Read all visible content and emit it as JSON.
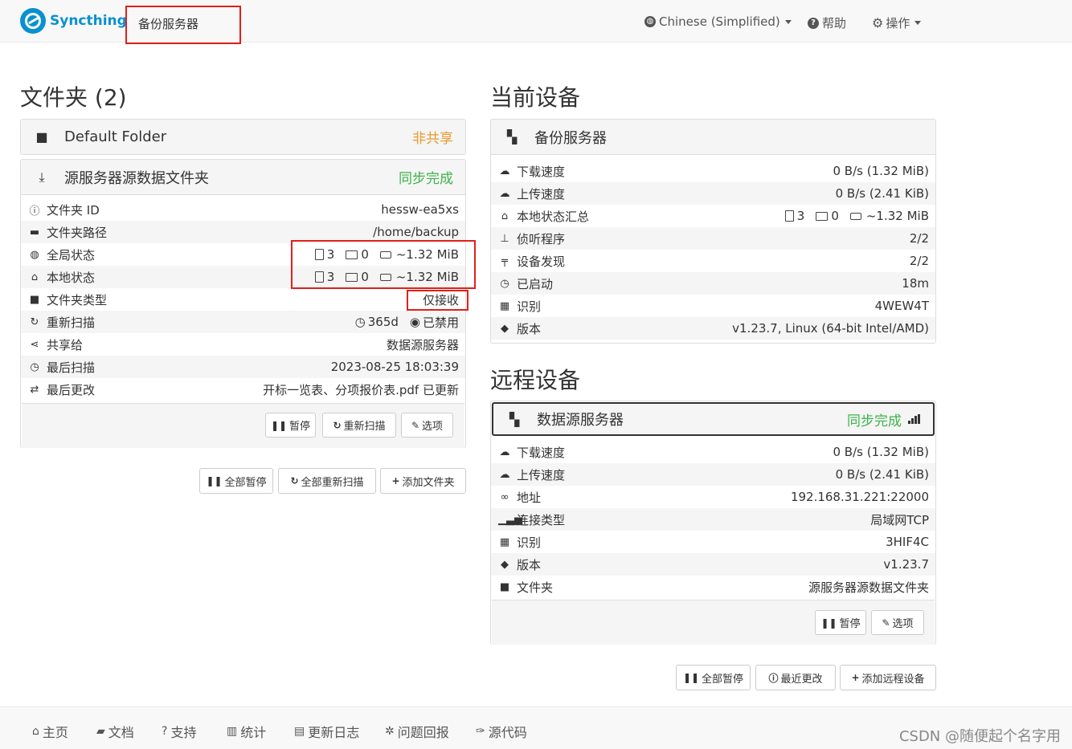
{
  "navbar": {
    "brand": "Syncthing",
    "device_name": "备份服务器",
    "language": "Chinese (Simplified)",
    "help": "帮助",
    "actions": "操作"
  },
  "folders": {
    "heading": "文件夹 (2)",
    "items": [
      {
        "name": "Default Folder",
        "status": "非共享"
      },
      {
        "name": "源服务器源数据文件夹",
        "status": "同步完成",
        "rows": [
          {
            "label": "文件夹 ID",
            "value": "hessw-ea5xs"
          },
          {
            "label": "文件夹路径",
            "value": "/home/backup"
          },
          {
            "label": "全局状态",
            "files": "3",
            "dirs": "0",
            "size": "~1.32 MiB"
          },
          {
            "label": "本地状态",
            "files": "3",
            "dirs": "0",
            "size": "~1.32 MiB"
          },
          {
            "label": "文件夹类型",
            "value": "仅接收"
          },
          {
            "label": "重新扫描",
            "interval": "365d",
            "watch": "已禁用"
          },
          {
            "label": "共享给",
            "value": "数据源服务器"
          },
          {
            "label": "最后扫描",
            "value": "2023-08-25 18:03:39"
          },
          {
            "label": "最后更改",
            "value": "开标一览表、分项报价表.pdf 已更新"
          }
        ],
        "buttons": {
          "pause": "暂停",
          "rescan": "重新扫描",
          "options": "选项"
        }
      }
    ],
    "actions": {
      "pause_all": "全部暂停",
      "rescan_all": "全部重新扫描",
      "add_folder": "添加文件夹"
    }
  },
  "this_device": {
    "heading": "当前设备",
    "name": "备份服务器",
    "rows": [
      {
        "label": "下载速度",
        "value": "0 B/s (1.32 MiB)"
      },
      {
        "label": "上传速度",
        "value": "0 B/s (2.41 KiB)"
      },
      {
        "label": "本地状态汇总",
        "files": "3",
        "dirs": "0",
        "size": "~1.32 MiB"
      },
      {
        "label": "侦听程序",
        "value": "2/2"
      },
      {
        "label": "设备发现",
        "value": "2/2"
      },
      {
        "label": "已启动",
        "value": "18m"
      },
      {
        "label": "识别",
        "value": "4WEW4T"
      },
      {
        "label": "版本",
        "value": "v1.23.7, Linux (64-bit Intel/AMD)"
      }
    ]
  },
  "remote_devices": {
    "heading": "远程设备",
    "device": {
      "name": "数据源服务器",
      "status": "同步完成",
      "rows": [
        {
          "label": "下载速度",
          "value": "0 B/s (1.32 MiB)"
        },
        {
          "label": "上传速度",
          "value": "0 B/s (2.41 KiB)"
        },
        {
          "label": "地址",
          "value": "192.168.31.221:22000"
        },
        {
          "label": "连接类型",
          "value": "局域网TCP"
        },
        {
          "label": "识别",
          "value": "3HIF4C"
        },
        {
          "label": "版本",
          "value": "v1.23.7"
        },
        {
          "label": "文件夹",
          "value": "源服务器源数据文件夹"
        }
      ],
      "buttons": {
        "pause": "暂停",
        "options": "选项"
      }
    },
    "actions": {
      "pause_all": "全部暂停",
      "recent_changes": "最近更改",
      "add_device": "添加远程设备"
    }
  },
  "footer": {
    "links": [
      "主页",
      "文档",
      "支持",
      "统计",
      "更新日志",
      "问题回报",
      "源代码"
    ],
    "watermark": "CSDN @随便起个名字用"
  },
  "colors": {
    "accent": "#0891d1",
    "green": "#3cb44b",
    "orange": "#e89a2e",
    "link": "#2a9fd6",
    "highlight": "#e0201b"
  }
}
